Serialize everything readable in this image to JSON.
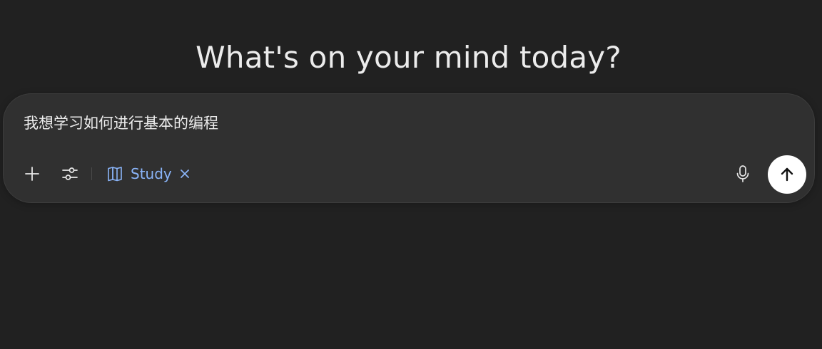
{
  "headline": "What's on your mind today?",
  "composer": {
    "input_value": "我想学习如何进行基本的编程",
    "active_tool": {
      "label": "Study",
      "icon": "book-open-icon",
      "remove_icon": "close-icon",
      "color": "#8ab4f8"
    },
    "buttons": {
      "add": "plus-icon",
      "tools": "sliders-icon",
      "voice": "microphone-icon",
      "send": "arrow-up-icon"
    }
  },
  "colors": {
    "background": "#212121",
    "composer_background": "#303030",
    "text": "#ececec",
    "send_button": "#ffffff"
  }
}
